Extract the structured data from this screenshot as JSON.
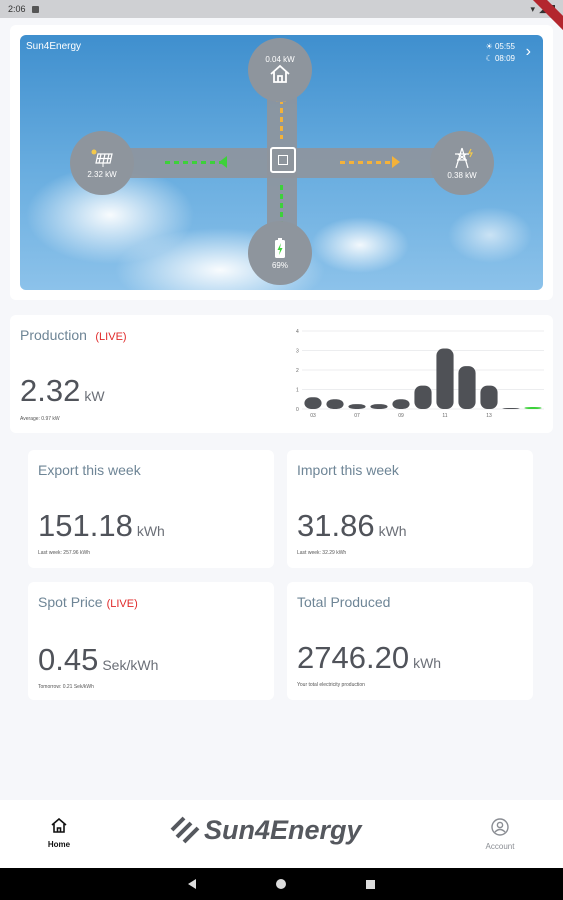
{
  "status_bar": {
    "time": "2:06"
  },
  "hero": {
    "brand": "Sun4Energy",
    "sunrise": "05:55",
    "sunset": "08:09",
    "nodes": {
      "home": {
        "value": "0.04 kW"
      },
      "solar": {
        "value": "2.32 kW"
      },
      "grid": {
        "value": "0.38 kW"
      },
      "battery": {
        "value": "69%"
      }
    },
    "colors": {
      "solar_flow": "#3dd13a",
      "grid_flow": "#f3b23a",
      "home_flow": "#f3b23a",
      "battery_flow": "#3dd13a"
    }
  },
  "production": {
    "title": "Production",
    "live": "(LIVE)",
    "value": "2.32",
    "unit": "kW",
    "average": "Average: 0.97 kW"
  },
  "chart_data": {
    "type": "bar",
    "categories": [
      "03",
      "",
      "07",
      "",
      "09",
      "",
      "11",
      "",
      "13",
      "",
      ""
    ],
    "values": [
      0.6,
      0.5,
      0.25,
      0.25,
      0.5,
      1.2,
      3.1,
      2.2,
      1.2,
      0.05,
      0
    ],
    "ylim": [
      0,
      4
    ],
    "yticks": [
      "0",
      "1",
      "2",
      "3",
      "4"
    ],
    "bar_color": "#4f5156",
    "live_color": "#3dd13a",
    "grid": true
  },
  "export_week": {
    "title": "Export this week",
    "value": "151.18",
    "unit": "kWh",
    "note": "Last week: 257.96 kWh"
  },
  "import_week": {
    "title": "Import this week",
    "value": "31.86",
    "unit": "kWh",
    "note": "Last week: 32.29 kWh"
  },
  "spot_price": {
    "title": "Spot Price",
    "live": "(LIVE)",
    "value": "0.45",
    "unit": "Sek/kWh",
    "note": "Tomorrow: 0.21 Sek/kWh"
  },
  "total_produced": {
    "title": "Total Produced",
    "value": "2746.20",
    "unit": "kWh",
    "note": "Your total electricity production"
  },
  "bottom_nav": {
    "home": "Home",
    "brand": "Sun4Energy",
    "account": "Account"
  }
}
